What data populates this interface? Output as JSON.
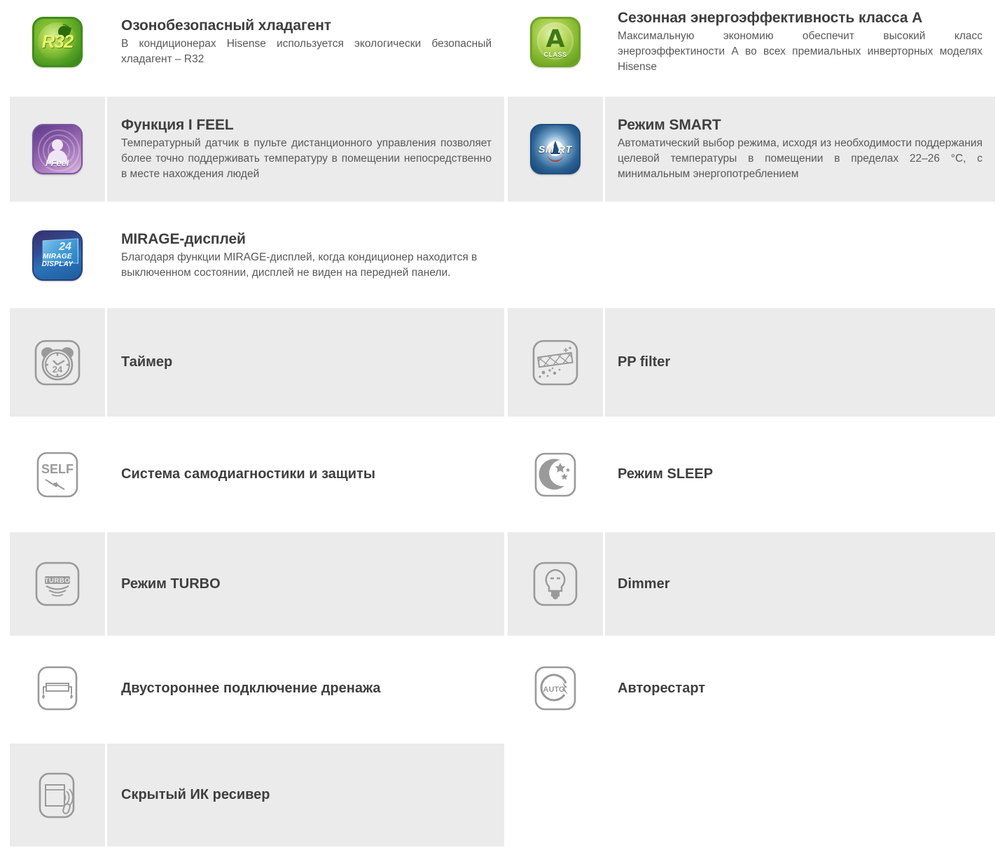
{
  "page": {
    "background": "#ffffff",
    "band_color": "#ebebeb",
    "title_color": "#3f3f3f",
    "body_color": "#595959"
  },
  "features": [
    {
      "id": "r32",
      "icon": "r32-refrigerant-icon",
      "icon_text": "R32",
      "title": "Озонобезопасный хладагент",
      "desc": "В кондиционерах Hisense используется экологически безопасный хладагент – R32",
      "banded": false,
      "column": "left",
      "row": 0
    },
    {
      "id": "a-class",
      "icon": "energy-class-a-icon",
      "icon_text": "A",
      "icon_subtext": "CLASS",
      "title": "Сезонная энергоэффективность класса A",
      "desc": "Максимальную экономию обеспечит высокий класс энергоэффектиности А во всех премиальных инверторных моделях Hisense",
      "banded": false,
      "column": "right",
      "row": 0
    },
    {
      "id": "i-feel",
      "icon": "i-feel-icon",
      "icon_text": "I Feel",
      "title": "Функция I FEEL",
      "desc": "Температурный датчик в пульте дистанционного управления позволяет более точно поддерживать температуру в помещении непосредственно в месте нахождения людей",
      "banded": true,
      "column": "left",
      "row": 1
    },
    {
      "id": "smart",
      "icon": "smart-mode-icon",
      "icon_text": "SM RT",
      "title": "Режим SMART",
      "desc": "Автоматический выбор режима, исходя из необходимости поддержания целевой температуры в помещении в пределах 22–26 °С, с минимальным энергопотреблением",
      "banded": true,
      "column": "right",
      "row": 1
    },
    {
      "id": "mirage",
      "icon": "mirage-display-icon",
      "icon_text": "MIRAGE",
      "icon_subtext": "DISPLAY",
      "icon_number": "24",
      "title": "MIRAGE-дисплей",
      "desc": "Благодаря функции MIRAGE-дисплей, когда кондиционер находится в выключенном состоянии, дисплей не виден на передней панели.",
      "banded": false,
      "column": "left",
      "row": 2
    },
    {
      "id": "timer",
      "icon": "alarm-clock-24h-icon",
      "icon_text": "24",
      "label": "Таймер",
      "banded": true,
      "column": "left",
      "row": 3
    },
    {
      "id": "pp-filter",
      "icon": "pp-filter-icon",
      "label": "PP filter",
      "banded": true,
      "column": "right",
      "row": 3
    },
    {
      "id": "self-diagnostic",
      "icon": "self-diagnostic-icon",
      "icon_text": "SELF",
      "label": "Система самодиагностики и защиты",
      "banded": false,
      "column": "left",
      "row": 4
    },
    {
      "id": "sleep",
      "icon": "moon-stars-sleep-icon",
      "label": "Режим SLEEP",
      "banded": false,
      "column": "right",
      "row": 4
    },
    {
      "id": "turbo",
      "icon": "turbo-mode-icon",
      "icon_text": "TURBO",
      "label": "Режим TURBO",
      "banded": true,
      "column": "left",
      "row": 5
    },
    {
      "id": "dimmer",
      "icon": "light-bulb-dimmer-icon",
      "label": "Dimmer",
      "banded": true,
      "column": "right",
      "row": 5
    },
    {
      "id": "drainage",
      "icon": "two-side-drainage-icon",
      "label": "Двустороннее подключение дренажа",
      "banded": false,
      "column": "left",
      "row": 6
    },
    {
      "id": "auto-restart",
      "icon": "auto-restart-icon",
      "icon_text": "AUTO",
      "label": "Авторестарт",
      "banded": false,
      "column": "right",
      "row": 6
    },
    {
      "id": "ir-receiver",
      "icon": "hidden-ir-receiver-icon",
      "label": "Скрытый ИК ресивер",
      "banded": true,
      "column": "left",
      "row": 7
    }
  ]
}
